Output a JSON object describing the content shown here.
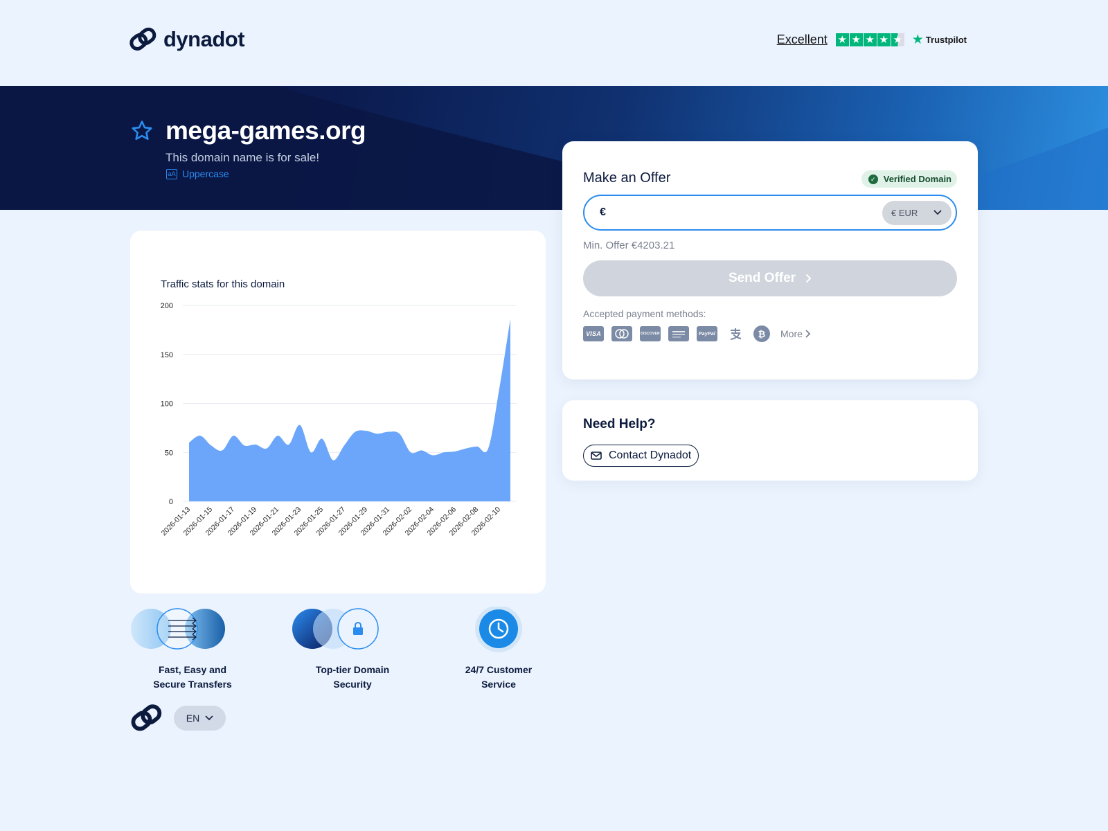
{
  "brand": {
    "name": "dynadot"
  },
  "trustpilot": {
    "rating_text": "Excellent",
    "stars_full": 4,
    "stars_half": 1,
    "logo_text": "Trustpilot"
  },
  "hero": {
    "domain": "mega-games.org",
    "subtitle": "This domain name is for sale!",
    "case_icon": "aA",
    "case_label": "Uppercase"
  },
  "traffic": {
    "title": "Traffic stats for this domain"
  },
  "chart_data": {
    "type": "area",
    "title": "Traffic stats for this domain",
    "xlabel": "",
    "ylabel": "",
    "ylim": [
      0,
      200
    ],
    "yticks": [
      0,
      50,
      100,
      150,
      200
    ],
    "x": [
      "2026-01-13",
      "2026-01-14",
      "2026-01-15",
      "2026-01-16",
      "2026-01-17",
      "2026-01-18",
      "2026-01-19",
      "2026-01-20",
      "2026-01-21",
      "2026-01-22",
      "2026-01-23",
      "2026-01-24",
      "2026-01-25",
      "2026-01-26",
      "2026-01-27",
      "2026-01-28",
      "2026-01-29",
      "2026-01-30",
      "2026-01-31",
      "2026-02-01",
      "2026-02-02",
      "2026-02-03",
      "2026-02-04",
      "2026-02-05",
      "2026-02-06",
      "2026-02-07",
      "2026-02-08",
      "2026-02-09",
      "2026-02-10",
      "2026-02-11"
    ],
    "xtick_labels": [
      "2026-01-13",
      "2026-01-15",
      "2026-01-17",
      "2026-01-19",
      "2026-01-21",
      "2026-01-23",
      "2026-01-25",
      "2026-01-27",
      "2026-01-29",
      "2026-01-31",
      "2026-02-02",
      "2026-02-04",
      "2026-02-06",
      "2026-02-08",
      "2026-02-10"
    ],
    "values": [
      60,
      67,
      57,
      52,
      67,
      57,
      58,
      54,
      67,
      58,
      78,
      50,
      64,
      42,
      57,
      71,
      72,
      69,
      71,
      69,
      50,
      52,
      47,
      50,
      51,
      54,
      56,
      54,
      115,
      186
    ],
    "grid": true,
    "color": "#6ba6fb"
  },
  "features": [
    {
      "label_line1": "Fast, Easy and",
      "label_line2": "Secure Transfers",
      "icon": "transfer-icon"
    },
    {
      "label_line1": "Top-tier Domain",
      "label_line2": "Security",
      "icon": "lock-icon"
    },
    {
      "label_line1": "24/7 Customer",
      "label_line2": "Service",
      "icon": "clock-icon"
    }
  ],
  "footer": {
    "language": "EN"
  },
  "offer": {
    "title": "Make an Offer",
    "verified_label": "Verified Domain",
    "currency_symbol": "€",
    "input_value": "",
    "currency_selected": "€ EUR",
    "min_offer": "Min. Offer €4203.21",
    "send_label": "Send Offer",
    "payment_label": "Accepted payment methods:",
    "payment_methods": [
      "VISA",
      "Mastercard",
      "Discover",
      "American Express",
      "PayPal",
      "Alipay",
      "Bitcoin"
    ],
    "more_label": "More"
  },
  "help": {
    "title": "Need Help?",
    "contact_label": "Contact Dynadot"
  },
  "colors": {
    "accent": "#2b8cf0",
    "navy": "#0b1a3d",
    "verified_green": "#1d6b3e",
    "trust_green": "#00b67a"
  }
}
